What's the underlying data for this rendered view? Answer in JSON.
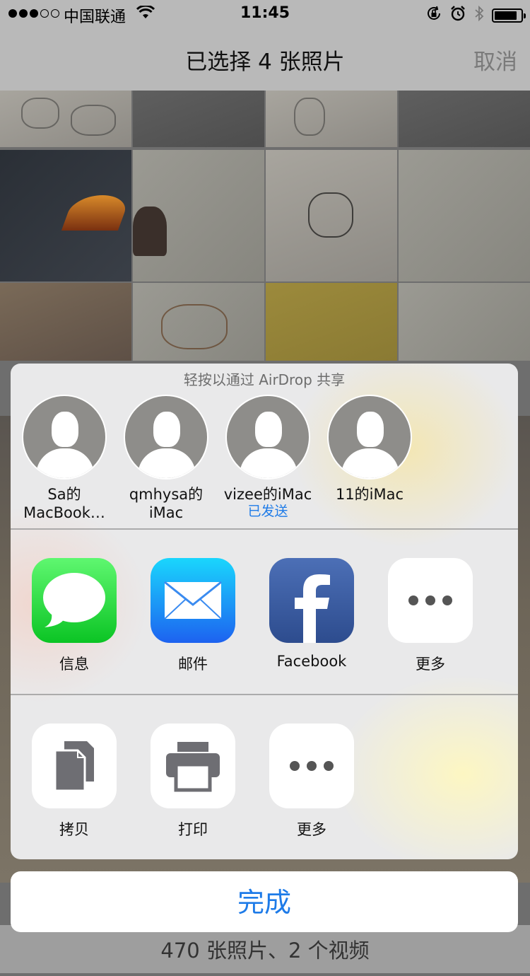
{
  "status_bar": {
    "carrier": "中国联通",
    "time": "11:45",
    "signal_strength": 3,
    "signal_max": 5,
    "battery_level": 0.85,
    "icons": [
      "wifi-icon",
      "orientation-lock-icon",
      "alarm-icon",
      "bluetooth-icon",
      "battery-icon"
    ]
  },
  "nav": {
    "title": "已选择 4 张照片",
    "cancel_label": "取消"
  },
  "photos": {
    "count_text": "470 张照片、2 个视频"
  },
  "share_sheet": {
    "airdrop_title": "轻按以通过 AirDrop 共享",
    "contacts": [
      {
        "name": "Sa的\nMacBook…",
        "status": ""
      },
      {
        "name": "qmhysa的\niMac",
        "status": ""
      },
      {
        "name": "vizee的iMac",
        "status": "已发送"
      },
      {
        "name": "11的iMac",
        "status": ""
      }
    ],
    "apps": [
      {
        "label": "信息",
        "icon": "messages-icon"
      },
      {
        "label": "邮件",
        "icon": "mail-icon"
      },
      {
        "label": "Facebook",
        "icon": "facebook-icon"
      },
      {
        "label": "更多",
        "icon": "more-icon"
      }
    ],
    "actions": [
      {
        "label": "拷贝",
        "icon": "copy-icon"
      },
      {
        "label": "打印",
        "icon": "print-icon"
      },
      {
        "label": "更多",
        "icon": "more-icon"
      }
    ],
    "done_label": "完成"
  },
  "colors": {
    "accent": "#1e7be8",
    "messages_green": "#0bc424",
    "mail_blue": "#1d62f0",
    "facebook_blue": "#3b5998"
  }
}
